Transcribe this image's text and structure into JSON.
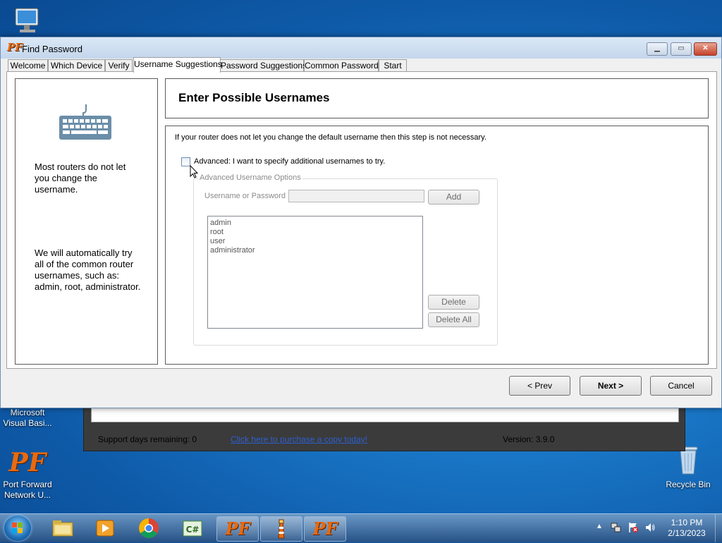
{
  "desktop": {
    "icons": [
      {
        "label": "Microsoft Visual Basi...",
        "icon": "visual-basic-icon"
      },
      {
        "label": "Port Forward Network U...",
        "icon": "port-forward-icon"
      },
      {
        "label": "Recycle Bin",
        "icon": "recycle-bin-icon"
      }
    ]
  },
  "bg_window": {
    "support_text": "Support days remaining: 0",
    "purchase_link": "Click here to purchase a copy today!",
    "version": "Version: 3.9.0"
  },
  "dialog": {
    "title": "Find Password",
    "tabs": [
      {
        "label": "Welcome"
      },
      {
        "label": "Which Device"
      },
      {
        "label": "Verify"
      },
      {
        "label": "Username Suggestions",
        "active": true
      },
      {
        "label": "Password Suggestions"
      },
      {
        "label": "Common Passwords"
      },
      {
        "label": "Start"
      }
    ],
    "side": {
      "icon": "keyboard-icon",
      "text1": "Most routers do not let you change the username.",
      "text2": "We will automatically try all of the common router usernames, such as: admin, root, administrator."
    },
    "header": "Enter Possible Usernames",
    "info": "If your router does not let you change the default username then this step is not necessary.",
    "advanced_checkbox": {
      "label": "Advanced: I want to specify additional usernames to try.",
      "checked": false
    },
    "group": {
      "title": "Advanced Username Options",
      "field_label": "Username or Password",
      "field_value": "",
      "add": "Add",
      "list": [
        "admin",
        "root",
        "user",
        "administrator"
      ],
      "delete": "Delete",
      "delete_all": "Delete All"
    },
    "buttons": {
      "prev": "< Prev",
      "next": "Next >",
      "cancel": "Cancel"
    }
  },
  "taskbar": {
    "apps": [
      "file-explorer-icon",
      "media-player-icon",
      "chrome-icon",
      "csharp-icon",
      "port-forward-icon",
      "lighthouse-icon",
      "port-forward-icon"
    ],
    "time": "1:10 PM",
    "date": "2/13/2023"
  }
}
